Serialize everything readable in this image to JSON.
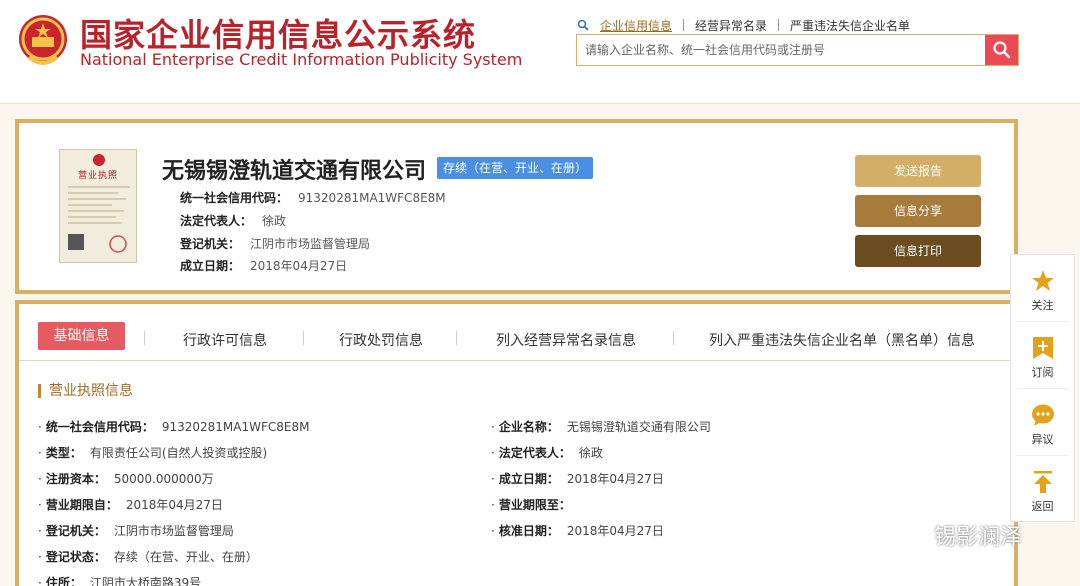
{
  "header": {
    "title_cn": "国家企业信用信息公示系统",
    "title_en": "National Enterprise Credit Information Publicity System",
    "links": [
      "企业信用信息",
      "经营异常名录",
      "严重违法失信企业名单"
    ],
    "search_placeholder": "请输入企业名称、统一社会信用代码或注册号"
  },
  "company": {
    "license_title": "营业执照",
    "name": "无锡锡澄轨道交通有限公司",
    "status": "存续（在营、开业、在册）",
    "fields": [
      {
        "key": "统一社会信用代码：",
        "value": "91320281MA1WFC8E8M"
      },
      {
        "key": "法定代表人：",
        "value": "徐政"
      },
      {
        "key": "登记机关：",
        "value": "江阴市市场监督管理局"
      },
      {
        "key": "成立日期：",
        "value": "2018年04月27日"
      }
    ],
    "buttons": {
      "report": "发送报告",
      "share": "信息分享",
      "print": "信息打印"
    }
  },
  "tabs": [
    "基础信息",
    "行政许可信息",
    "行政处罚信息",
    "列入经营异常名录信息",
    "列入严重违法失信企业名单（黑名单）信息"
  ],
  "section": {
    "title": "营业执照信息",
    "left": [
      {
        "key": "统一社会信用代码：",
        "value": "91320281MA1WFC8E8M"
      },
      {
        "key": "类型：",
        "value": "有限责任公司(自然人投资或控股)"
      },
      {
        "key": "注册资本：",
        "value": "50000.000000万"
      },
      {
        "key": "营业期限自：",
        "value": "2018年04月27日"
      },
      {
        "key": "登记机关：",
        "value": "江阴市市场监督管理局"
      },
      {
        "key": "登记状态：",
        "value": "存续（在营、开业、在册）"
      },
      {
        "key": "住所：",
        "value": "江阴市大桥南路39号"
      }
    ],
    "right": [
      {
        "key": "企业名称：",
        "value": "无锡锡澄轨道交通有限公司"
      },
      {
        "key": "法定代表人：",
        "value": "徐政"
      },
      {
        "key": "成立日期：",
        "value": "2018年04月27日"
      },
      {
        "key": "营业期限至：",
        "value": ""
      },
      {
        "key": "核准日期：",
        "value": "2018年04月27日"
      }
    ]
  },
  "floatbar": [
    "关注",
    "订阅",
    "异议",
    "返回"
  ],
  "watermark": "锡影澜泽",
  "colors": {
    "brand_red": "#b8222b",
    "gold": "#d9b060",
    "tab_active": "#e55b61",
    "status_blue": "#4a90e2"
  }
}
